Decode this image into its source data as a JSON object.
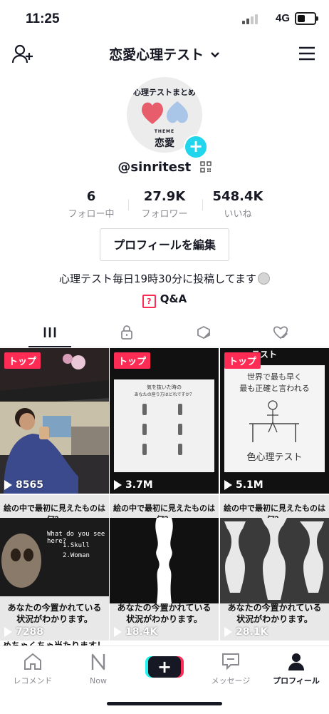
{
  "status_bar": {
    "time": "11:25",
    "network": "4G"
  },
  "header": {
    "title": "恋愛心理テスト",
    "dropdown_icon": "chevron-down-icon",
    "left_icon": "add-user-icon",
    "right_icon": "menu-icon"
  },
  "avatar": {
    "top_text": "心理テストまとめ",
    "theme_label": "THEME",
    "theme_text": "恋愛"
  },
  "profile": {
    "username": "@sinritest",
    "stats": [
      {
        "value": "6",
        "label": "フォロー中"
      },
      {
        "value": "27.9K",
        "label": "フォロワー"
      },
      {
        "value": "548.4K",
        "label": "いいね"
      }
    ],
    "edit_button": "プロフィールを編集",
    "bio": "心理テスト毎日19時30分に投稿してます",
    "qa_label": "Q&A"
  },
  "tabs": [
    "videos-grid",
    "private-lock",
    "reposts",
    "liked"
  ],
  "videos": [
    {
      "pinned_label": "トップ",
      "views": "8565"
    },
    {
      "pinned_label": "トップ",
      "views": "3.7M",
      "overlay_title": "気を抜いた時の",
      "overlay_sub": "あなたの座り方はどれですか？"
    },
    {
      "pinned_label": "トップ",
      "views": "5.1M",
      "overlay_line1": "世界で最も早く",
      "overlay_line2": "最も正確と言われる",
      "overlay_line3": "色心理テスト",
      "top_fragment": "テスト"
    },
    {
      "views": "7288",
      "header_text": "絵の中で最初に見えたものは何？",
      "eng_q": "What do you see here?",
      "opt1": "1.Skull",
      "opt2": "2.Woman",
      "caption1": "あなたの今置かれている",
      "caption2": "状況がわかります。"
    },
    {
      "views": "18.4K",
      "header_text": "絵の中で最初に見えたものは何？",
      "caption1": "あなたの今置かれている",
      "caption2": "状況がわかります。"
    },
    {
      "views": "28.1K",
      "header_text": "絵の中で最初に見えたものは何？",
      "caption1": "あなたの今置かれている",
      "caption2": "状況がわかります。"
    }
  ],
  "partial_row_text": "めちゃくちゃ当たります！",
  "bottom_nav": [
    {
      "label": "レコメンド",
      "icon": "home-icon"
    },
    {
      "label": "Now",
      "icon": "now-icon"
    },
    {
      "label": "",
      "icon": "create-plus-icon"
    },
    {
      "label": "メッセージ",
      "icon": "message-icon"
    },
    {
      "label": "プロフィール",
      "icon": "profile-icon"
    }
  ],
  "colors": {
    "accent": "#fe2c55",
    "cyan": "#20d5ec",
    "text": "#161823",
    "muted": "#8a8b91"
  }
}
